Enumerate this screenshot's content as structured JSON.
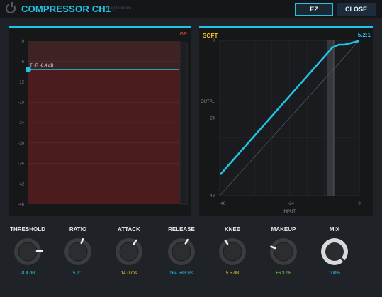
{
  "header": {
    "title": "COMPRESSOR CH1",
    "drag_hint": "drag to move",
    "ez_label": "EZ",
    "close_label": "CLOSE"
  },
  "gr_panel": {
    "gr_label": "GR",
    "threshold_label": "THR -8.4 dB",
    "db_ticks": [
      "0",
      "-6",
      "-12",
      "-18",
      "-24",
      "-30",
      "-36",
      "-42",
      "-48"
    ]
  },
  "curve_panel": {
    "mode_label": "SOFT",
    "ratio_label": "5.2:1",
    "y_axis_label": "OUTP...",
    "x_axis_label": "INPUT",
    "y_ticks": [
      "0",
      "-24",
      "-48"
    ],
    "x_ticks": [
      "-48",
      "-24",
      "0"
    ]
  },
  "knobs": [
    {
      "name": "THRESHOLD",
      "value": "-8.4 dB",
      "value_color": "#22c4e6",
      "style": "dark-ring-white",
      "amount": 0.82
    },
    {
      "name": "RATIO",
      "value": "5.2:1",
      "value_color": "#22c4e6",
      "style": "dark",
      "amount": 0.58
    },
    {
      "name": "ATTACK",
      "value": "14.0 ms",
      "value_color": "#f3c624",
      "style": "dark",
      "amount": 0.62
    },
    {
      "name": "RELEASE",
      "value": "164.583 ms",
      "value_color": "#22c4e6",
      "style": "dark",
      "amount": 0.6
    },
    {
      "name": "KNEE",
      "value": "5.5 dB",
      "value_color": "#f3c624",
      "style": "dark",
      "amount": 0.38
    },
    {
      "name": "MAKEUP",
      "value": "+6.3 dB",
      "value_color": "#7be04a",
      "style": "dark",
      "amount": 0.25
    },
    {
      "name": "MIX",
      "value": "100%",
      "value_color": "#22c4e6",
      "style": "light",
      "amount": 1.0
    }
  ],
  "colors": {
    "accent": "#22c4e6",
    "gr_red": "#4a1a1c",
    "soft_yellow": "#f3c624",
    "makeup_green": "#7be04a"
  }
}
